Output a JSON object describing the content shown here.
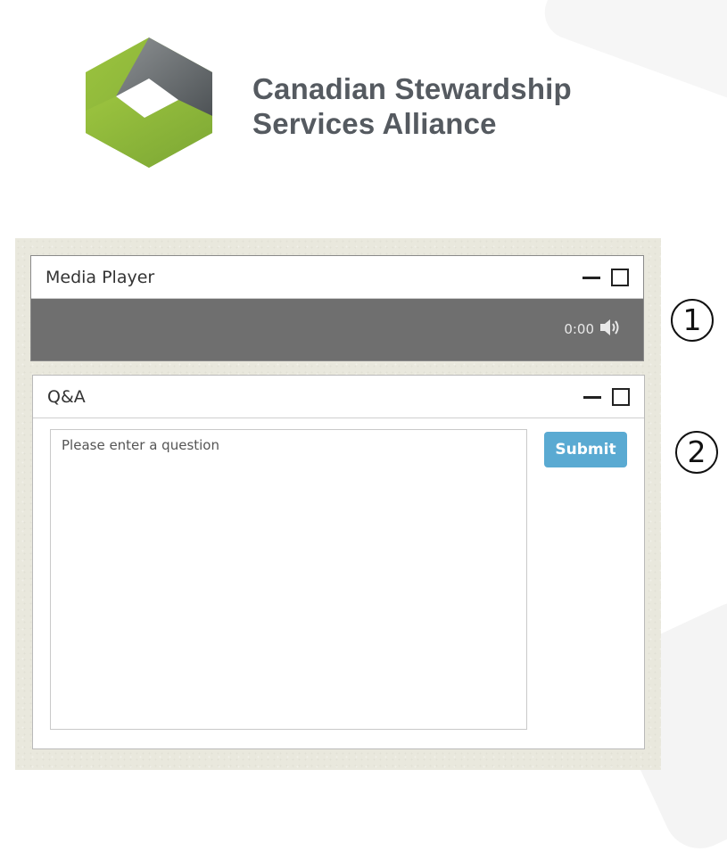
{
  "brand": {
    "line1": "Canadian Stewardship",
    "line2": "Services Alliance",
    "logo_colors": {
      "green": "#8fb83c",
      "gray": "#6b6f72"
    }
  },
  "media_player": {
    "title": "Media Player",
    "time": "0:00",
    "icons": [
      "minimize-icon",
      "maximize-icon",
      "speaker-icon"
    ]
  },
  "qa": {
    "title": "Q&A",
    "placeholder": "Please enter a question",
    "submit_label": "Submit",
    "submit_color": "#5aaad2"
  },
  "callouts": [
    "1",
    "2"
  ]
}
